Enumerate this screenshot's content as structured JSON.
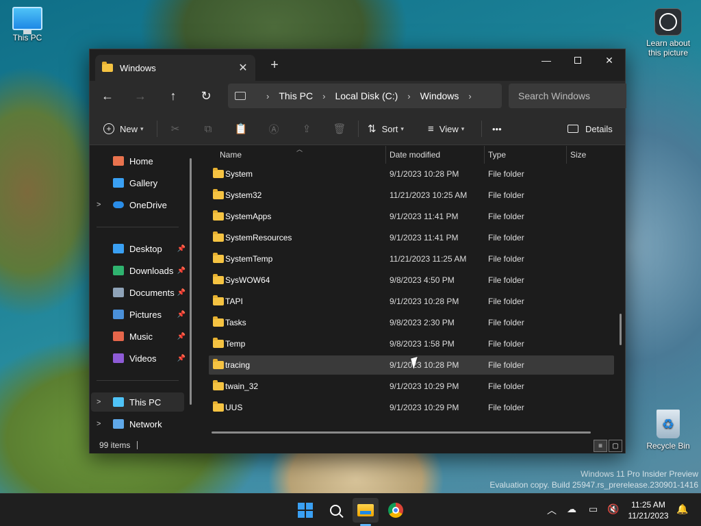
{
  "desktop": {
    "icons": {
      "this_pc": "This PC",
      "learn": "Learn about this picture",
      "recycle": "Recycle Bin"
    },
    "watermark": {
      "line1": "Windows 11 Pro Insider Preview",
      "line2": "Evaluation copy. Build 25947.rs_prerelease.230901-1416"
    }
  },
  "window": {
    "tab_title": "Windows",
    "new_tab": "+",
    "close_tab": "✕",
    "controls": {
      "minimize": "—",
      "close": "✕"
    }
  },
  "address": {
    "back": "←",
    "forward": "→",
    "up": "↑",
    "refresh": "↻",
    "crumbs": [
      "This PC",
      "Local Disk (C:)",
      "Windows"
    ],
    "search_placeholder": "Search Windows"
  },
  "toolbar": {
    "new_label": "New",
    "sort_label": "Sort",
    "view_label": "View",
    "more": "•••",
    "details_label": "Details",
    "icons": {
      "cut": "✂",
      "copy": "⧉",
      "paste": "📋",
      "rename": "Ⓐ",
      "share": "⇪",
      "delete": "🗑"
    }
  },
  "nav": {
    "items": [
      {
        "label": "Home"
      },
      {
        "label": "Gallery"
      },
      {
        "label": "OneDrive"
      },
      {
        "label": "Desktop"
      },
      {
        "label": "Downloads"
      },
      {
        "label": "Documents"
      },
      {
        "label": "Pictures"
      },
      {
        "label": "Music"
      },
      {
        "label": "Videos"
      },
      {
        "label": "This PC"
      },
      {
        "label": "Network"
      }
    ],
    "pin": "📌",
    "expand": ">"
  },
  "columns": {
    "name": "Name",
    "date": "Date modified",
    "type": "Type",
    "size": "Size"
  },
  "rows": [
    {
      "name": "System",
      "date": "9/1/2023 10:28 PM",
      "type": "File folder"
    },
    {
      "name": "System32",
      "date": "11/21/2023 10:25 AM",
      "type": "File folder"
    },
    {
      "name": "SystemApps",
      "date": "9/1/2023 11:41 PM",
      "type": "File folder"
    },
    {
      "name": "SystemResources",
      "date": "9/1/2023 11:41 PM",
      "type": "File folder"
    },
    {
      "name": "SystemTemp",
      "date": "11/21/2023 11:25 AM",
      "type": "File folder"
    },
    {
      "name": "SysWOW64",
      "date": "9/8/2023 4:50 PM",
      "type": "File folder"
    },
    {
      "name": "TAPI",
      "date": "9/1/2023 10:28 PM",
      "type": "File folder"
    },
    {
      "name": "Tasks",
      "date": "9/8/2023 2:30 PM",
      "type": "File folder"
    },
    {
      "name": "Temp",
      "date": "9/8/2023 1:58 PM",
      "type": "File folder"
    },
    {
      "name": "tracing",
      "date": "9/1/2023 10:28 PM",
      "type": "File folder"
    },
    {
      "name": "twain_32",
      "date": "9/1/2023 10:29 PM",
      "type": "File folder"
    },
    {
      "name": "UUS",
      "date": "9/1/2023 10:29 PM",
      "type": "File folder"
    }
  ],
  "status": {
    "count": "99 items"
  },
  "taskbar": {
    "clock_time": "11:25 AM",
    "clock_date": "11/21/2023",
    "tray": {
      "chevron": "︿",
      "bell": "🔔"
    }
  },
  "colors": {
    "accent": "#3aa0f3",
    "folder": "#f5c342",
    "window_bg": "#1c1c1c"
  }
}
